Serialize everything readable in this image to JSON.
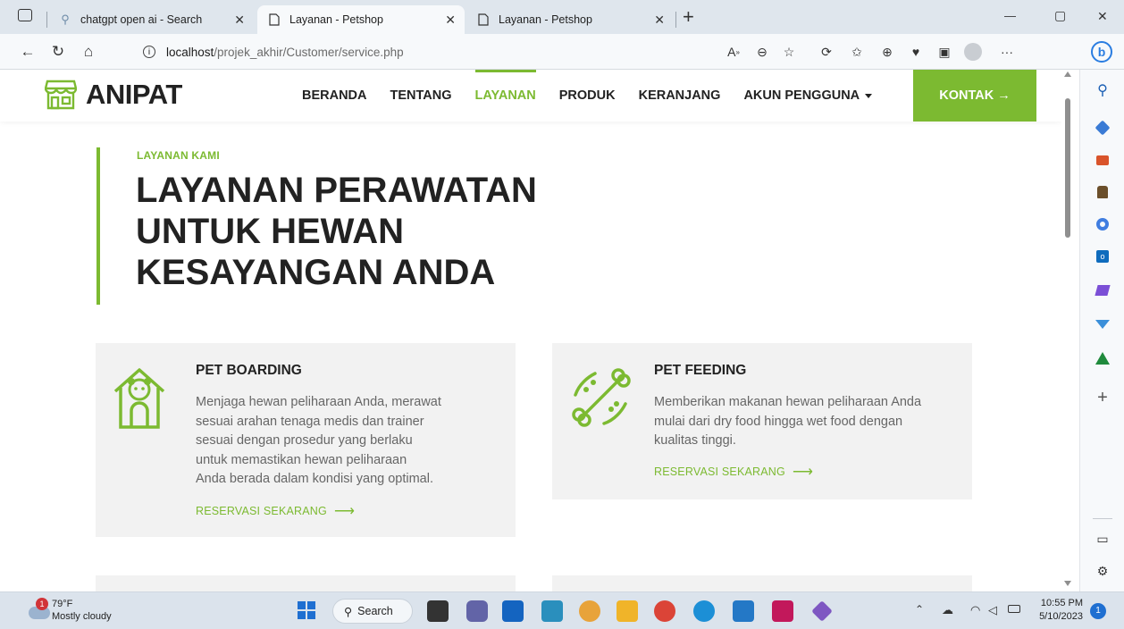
{
  "browser": {
    "tabs": [
      {
        "title": "chatgpt open ai - Search",
        "active": false
      },
      {
        "title": "Layanan - Petshop",
        "active": true
      },
      {
        "title": "Layanan - Petshop",
        "active": false
      }
    ],
    "new_tab": "+",
    "window_controls": {
      "minimize": "—",
      "restore": "▢",
      "close": "✕"
    },
    "url_host": "localhost",
    "url_path": "/projek_akhir/Customer/service.php",
    "more": "···"
  },
  "site": {
    "logo": "ANIPAT",
    "nav": [
      "BERANDA",
      "TENTANG",
      "LAYANAN",
      "PRODUK",
      "KERANJANG",
      "AKUN PENGGUNA"
    ],
    "active_nav": "LAYANAN",
    "contact_button": "KONTAK →",
    "kicker": "LAYANAN KAMI",
    "hero_lines": [
      "LAYANAN PERAWATAN",
      "UNTUK HEWAN",
      "KESAYANGAN ANDA"
    ],
    "services": [
      {
        "title": "PET BOARDING",
        "desc_lines": [
          "Menjaga hewan peliharaan Anda, merawat",
          "sesuai arahan tenaga medis dan trainer",
          "sesuai dengan prosedur yang berlaku",
          "untuk memastikan hewan peliharaan",
          "Anda berada dalam kondisi yang optimal."
        ],
        "link": "RESERVASI SEKARANG",
        "icon": "dog-house-icon"
      },
      {
        "title": "PET FEEDING",
        "desc_lines": [
          "Memberikan makanan hewan peliharaan Anda",
          "mulai dari dry food hingga wet food dengan",
          "kualitas tinggi."
        ],
        "link": "RESERVASI SEKARANG",
        "icon": "pet-food-icon"
      }
    ],
    "accent_color": "#7cba31"
  },
  "taskbar": {
    "weather_temp": "79°F",
    "weather_desc": "Mostly cloudy",
    "weather_badge": "1",
    "search_label": "Search",
    "time": "10:55 PM",
    "date": "5/10/2023",
    "notification_count": "1"
  }
}
